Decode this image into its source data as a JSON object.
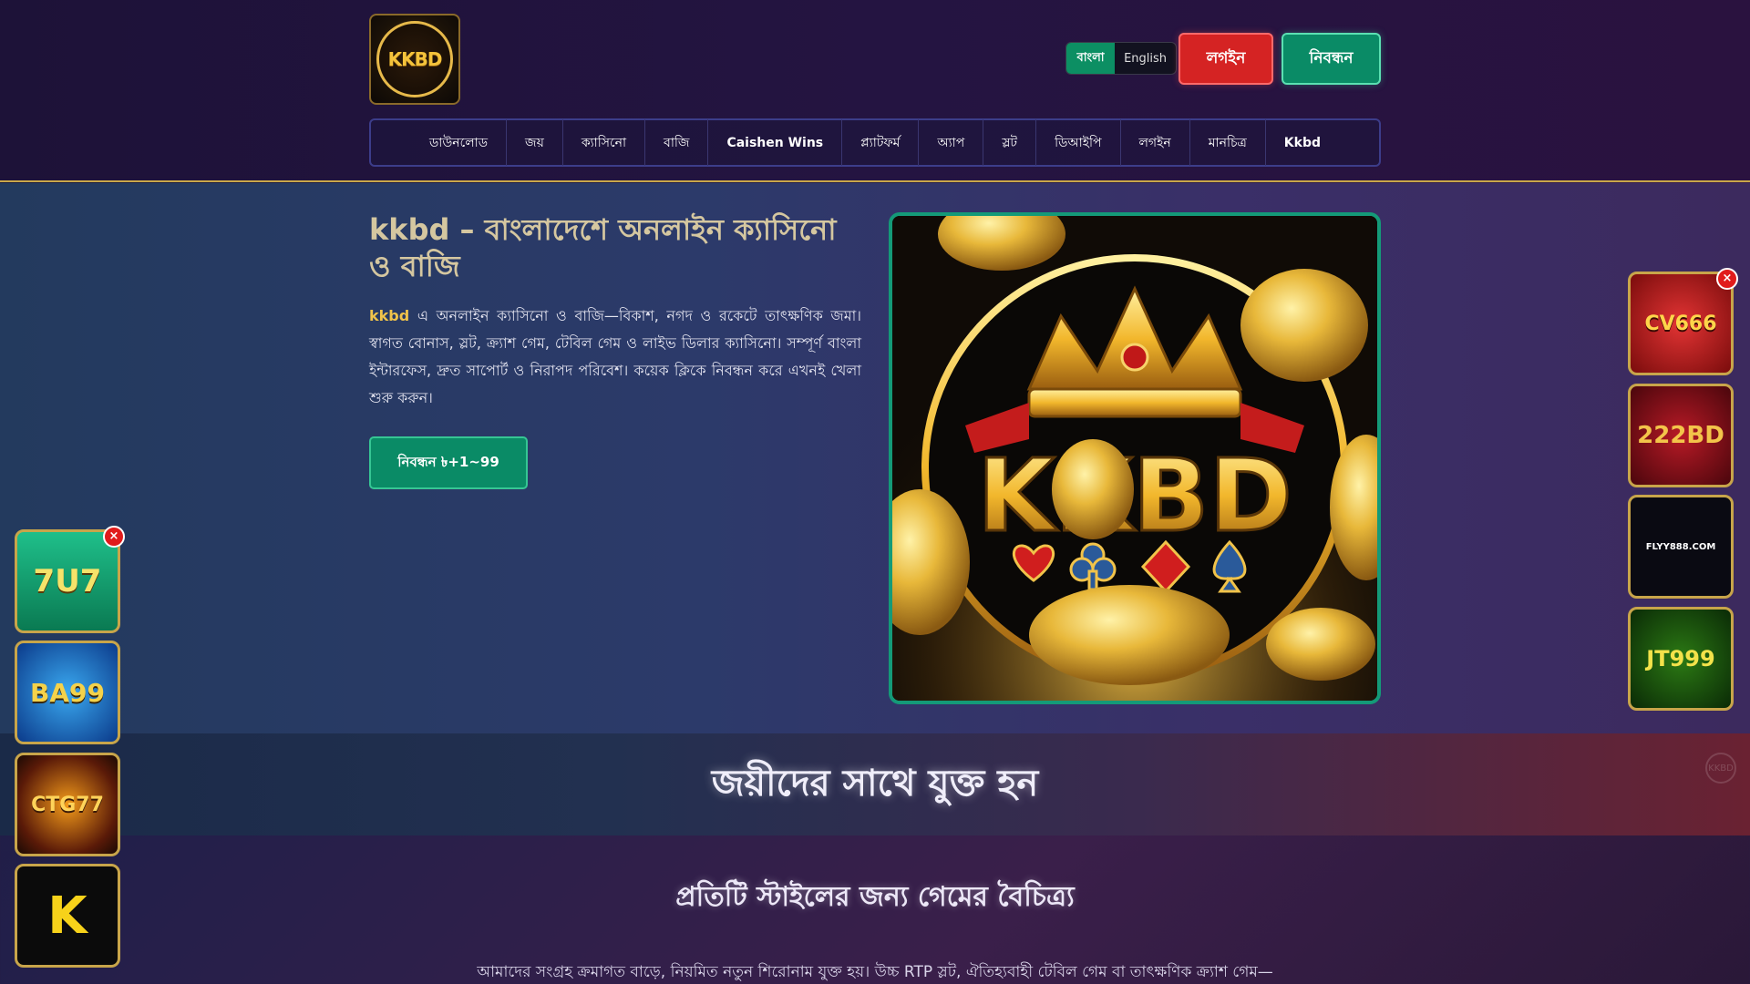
{
  "header": {
    "logo_text": "KKBD",
    "lang": {
      "bn": "বাংলা",
      "en": "English"
    },
    "login_label": "লগইন",
    "register_label": "নিবন্ধন"
  },
  "nav": {
    "items": [
      "ডাউনলোড",
      "জয়",
      "ক্যাসিনো",
      "বাজি",
      "Caishen Wins",
      "প্ল্যাটফর্ম",
      "অ্যাপ",
      "স্লট",
      "ডিআইপি",
      "লগইন",
      "মানচিত্র",
      "Kkbd"
    ]
  },
  "hero": {
    "title": "kkbd – বাংলাদেশে অনলাইন ক্যাসিনো ও বাজি",
    "brand": "kkbd",
    "desc": " এ অনলাইন ক্যাসিনো ও বাজি—বিকাশ, নগদ ও রকেটে তাৎক্ষণিক জমা। স্বাগত বোনাস, স্লট, ক্র্যাশ গেম, টেবিল গেম ও লাইভ ডিলার ক্যাসিনো। সম্পূর্ণ বাংলা ইন্টারফেস, দ্রুত সাপোর্ট ও নিরাপদ পরিবেশ। কয়েক ক্লিকে নিবন্ধন করে এখনই খেলা শুরু করুন।",
    "cta": "নিবন্ধন ৳+1~99",
    "image_text": "KKBD"
  },
  "join": {
    "title": "জয়ীদের সাথে যুক্ত হন",
    "icon_text": "KKBD"
  },
  "games": {
    "title": "প্রতিটি স্টাইলের জন্য গেমের বৈচিত্র্য",
    "desc": "আমাদের সংগ্রহ ক্রমাগত বাড়ে, নিয়মিত নতুন শিরোনাম যুক্ত হয়। উচ্চ RTP স্লট, ঐতিহ্যবাহী টেবিল গেম বা তাৎক্ষণিক ক্র্যাশ গেম—"
  },
  "ads": {
    "close_label": "×",
    "left": [
      "7U7",
      "BA99",
      "CTG77",
      "K"
    ],
    "right": [
      "CV666",
      "222BD",
      "FLYY888.COM",
      "JT999"
    ]
  }
}
